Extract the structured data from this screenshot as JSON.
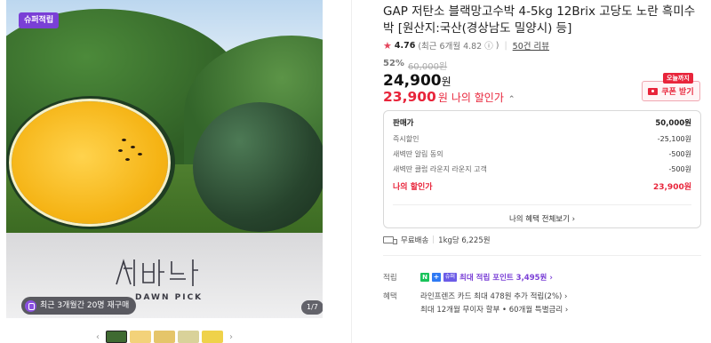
{
  "product_image": {
    "top_badge": "슈퍼적립",
    "logo_en": "DAWN PICK",
    "logo_ko": "새벽딴",
    "restock_text": "최근 3개월간 20명 재구매",
    "pager": "1/7"
  },
  "thumbnails": {
    "prev": "‹",
    "next": "›",
    "colors": [
      "#e8b52a",
      "#f3d27a",
      "#e5c56a",
      "#d9d29a",
      "#efd24a"
    ]
  },
  "product": {
    "title": "GAP 저탄소 블랙망고수박 4-5kg 12Brix 고당도 노란 흑미수박 [원산지:국산(경상남도 밀양시) 등]",
    "rating": "4.76",
    "rating_detail": "(최근 6개월 4.82",
    "rating_info_icon": "ⓘ",
    "rating_close": ")",
    "review_link": "50건 리뷰",
    "discount_pct": "52%",
    "original_price": "60,000원",
    "price": "24,900",
    "price_unit": "원",
    "my_price": "23,900",
    "my_price_unit": "원",
    "my_price_label": "나의 할인가",
    "my_price_caret": "⌃",
    "today_tag": "오늘까지",
    "coupon_label": "쿠폰 받기"
  },
  "price_box": {
    "rows": [
      {
        "label": "판매가",
        "value": "50,000원"
      },
      {
        "label": "즉시할인",
        "value": "-25,100원"
      },
      {
        "label": "새벽딴 알림 동의",
        "value": "-500원"
      },
      {
        "label": "새벽딴 클럽 라운지 라운지 고객",
        "value": "-500원"
      }
    ],
    "mine_label": "나의 할인가",
    "mine_value": "23,900원",
    "all_benefit": "나의 혜택 전체보기 ›"
  },
  "shipping": {
    "free": "무료배송",
    "per_kg": "1kg당 6,225원"
  },
  "points": {
    "label": "적립",
    "n_badge": "N",
    "plus_badge": "+",
    "sub_badge": "슈퍼",
    "text": "최대 적립 포인트 3,495원 ›"
  },
  "benefits": {
    "label": "혜택",
    "line1": "라인프렌즈 카드 최대 478원 추가 적립(2%) ›",
    "line2": "최대 12개월 무이자 할부 • 60개월 특별금리 ›"
  },
  "colors": {
    "accent_red": "#e8253b",
    "purple": "#7a3fd6"
  }
}
